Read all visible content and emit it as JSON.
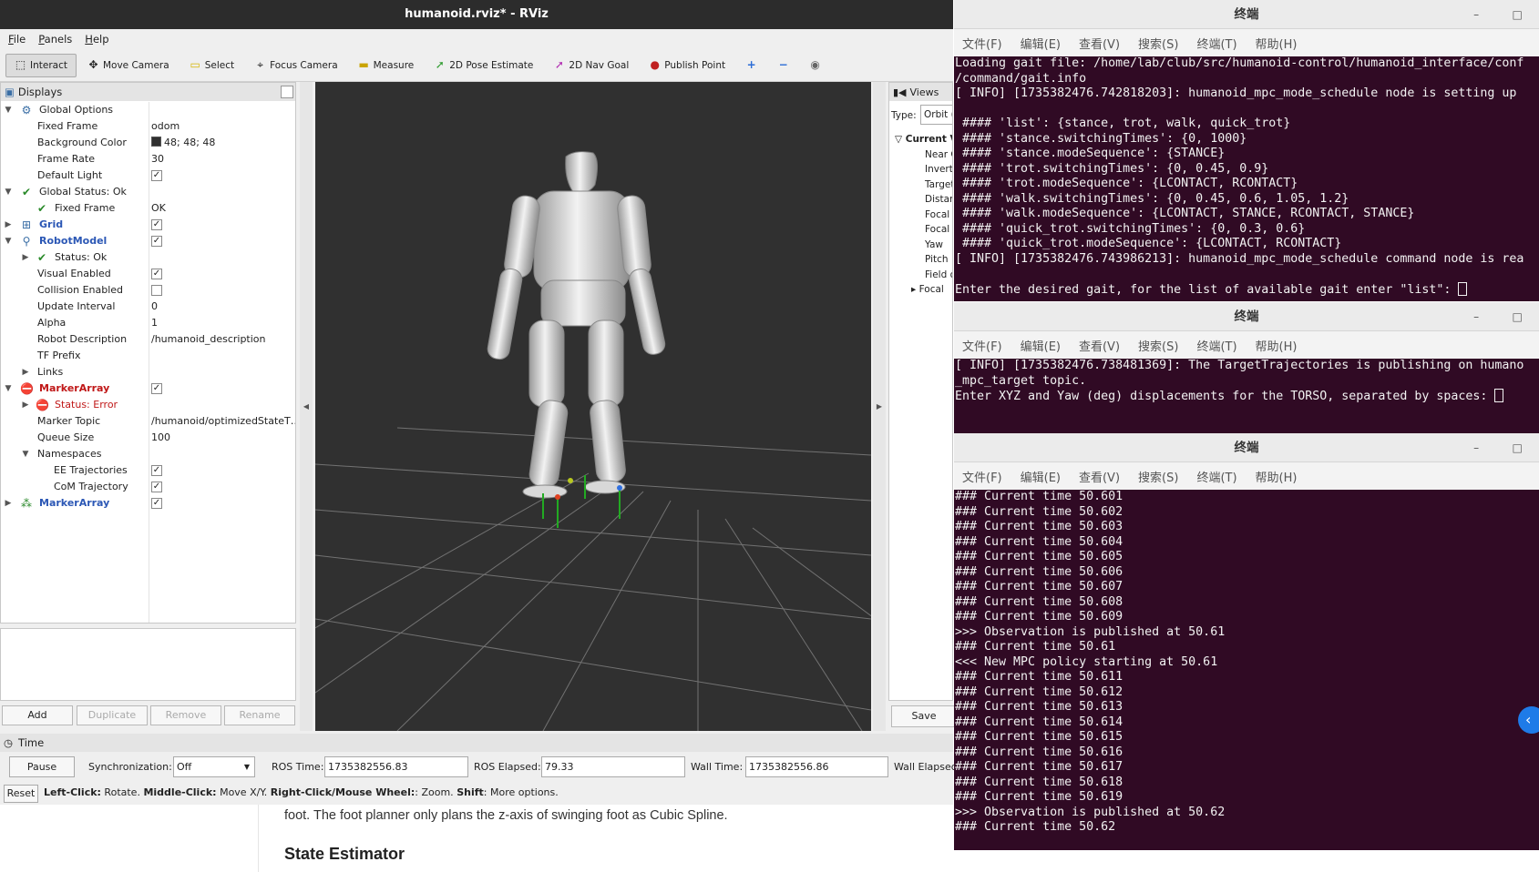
{
  "rviz": {
    "title": "humanoid.rviz* - RViz",
    "menu": [
      "File",
      "Panels",
      "Help"
    ],
    "tools": [
      {
        "label": "Interact",
        "icon": "interact-icon",
        "glyph": "⬚"
      },
      {
        "label": "Move Camera",
        "icon": "move-camera-icon",
        "glyph": "✥"
      },
      {
        "label": "Select",
        "icon": "select-icon",
        "glyph": "▭"
      },
      {
        "label": "Focus Camera",
        "icon": "focus-camera-icon",
        "glyph": "⌖"
      },
      {
        "label": "Measure",
        "icon": "measure-icon",
        "glyph": "▬"
      },
      {
        "label": "2D Pose Estimate",
        "icon": "pose-estimate-icon",
        "glyph": "➚"
      },
      {
        "label": "2D Nav Goal",
        "icon": "nav-goal-icon",
        "glyph": "➚"
      },
      {
        "label": "Publish Point",
        "icon": "publish-point-icon",
        "glyph": "📍"
      }
    ],
    "displays": {
      "title": "Displays",
      "global_options": "Global Options",
      "fixed_frame_label": "Fixed Frame",
      "fixed_frame_value": "odom",
      "bg_color_label": "Background Color",
      "bg_color_value": "48; 48; 48",
      "frame_rate_label": "Frame Rate",
      "frame_rate_value": "30",
      "default_light_label": "Default Light",
      "global_status": "Global Status: Ok",
      "gs_fixed_frame": "Fixed Frame",
      "gs_fixed_frame_value": "OK",
      "grid": "Grid",
      "robot_model": "RobotModel",
      "rm_status": "Status: Ok",
      "visual_enabled": "Visual Enabled",
      "collision_enabled": "Collision Enabled",
      "update_interval": "Update Interval",
      "update_interval_value": "0",
      "alpha": "Alpha",
      "alpha_value": "1",
      "robot_description": "Robot Description",
      "robot_description_value": "/humanoid_description",
      "tf_prefix": "TF Prefix",
      "links": "Links",
      "marker_array": "MarkerArray",
      "ma_status": "Status: Error",
      "marker_topic": "Marker Topic",
      "marker_topic_value": "/humanoid/optimizedStateT…",
      "queue_size": "Queue Size",
      "queue_size_value": "100",
      "namespaces": "Namespaces",
      "ee_traj": "EE Trajectories",
      "com_traj": "CoM Trajectory",
      "marker_array2": "MarkerArray"
    },
    "panel_buttons": {
      "add": "Add",
      "duplicate": "Duplicate",
      "remove": "Remove",
      "rename": "Rename"
    },
    "views": {
      "title": "Views",
      "type_label": "Type:",
      "type_value": "Orbit (",
      "current": "Current V",
      "props": [
        "Near C",
        "Invert",
        "Target",
        "Distan",
        "Focal S",
        "Focal S",
        "Yaw",
        "Pitch",
        "Field o",
        "Focal"
      ],
      "save": "Save"
    },
    "time": {
      "title": "Time",
      "pause": "Pause",
      "sync_label": "Synchronization:",
      "sync_value": "Off",
      "ros_time_label": "ROS Time:",
      "ros_time_value": "1735382556.83",
      "ros_elapsed_label": "ROS Elapsed:",
      "ros_elapsed_value": "79.33",
      "wall_time_label": "Wall Time:",
      "wall_time_value": "1735382556.86",
      "wall_elapsed_label": "Wall Elapsed"
    },
    "status": {
      "reset": "Reset",
      "left_click": "Left-Click:",
      "left_desc": " Rotate. ",
      "middle_click": "Middle-Click:",
      "middle_desc": " Move X/Y. ",
      "right_click": "Right-Click/Mouse Wheel:",
      "right_desc": ": Zoom. ",
      "shift": "Shift",
      "shift_desc": ": More options."
    }
  },
  "browser": {
    "text": "foot. The foot planner only plans the z-axis of swinging foot as Cubic Spline.",
    "heading": "State Estimator"
  },
  "terminal_menu": [
    "文件(F)",
    "编辑(E)",
    "查看(V)",
    "搜索(S)",
    "终端(T)",
    "帮助(H)"
  ],
  "terminals": [
    {
      "title": "终端",
      "lines": [
        "Loading gait file: /home/lab/club/src/humanoid-control/humanoid_interface/conf",
        "/command/gait.info",
        "[ INFO] [1735382476.742818203]: humanoid_mpc_mode_schedule node is setting up",
        "",
        " #### 'list': {stance, trot, walk, quick_trot}",
        " #### 'stance.switchingTimes': {0, 1000}",
        " #### 'stance.modeSequence': {STANCE}",
        " #### 'trot.switchingTimes': {0, 0.45, 0.9}",
        " #### 'trot.modeSequence': {LCONTACT, RCONTACT}",
        " #### 'walk.switchingTimes': {0, 0.45, 0.6, 1.05, 1.2}",
        " #### 'walk.modeSequence': {LCONTACT, STANCE, RCONTACT, STANCE}",
        " #### 'quick_trot.switchingTimes': {0, 0.3, 0.6}",
        " #### 'quick_trot.modeSequence': {LCONTACT, RCONTACT}",
        "[ INFO] [1735382476.743986213]: humanoid_mpc_mode_schedule command node is rea",
        "",
        "Enter the desired gait, for the list of available gait enter \"list\": "
      ]
    },
    {
      "title": "终端",
      "lines": [
        "[ INFO] [1735382476.738481369]: The TargetTrajectories is publishing on humano",
        "_mpc_target topic.",
        "Enter XYZ and Yaw (deg) displacements for the TORSO, separated by spaces: "
      ]
    },
    {
      "title": "终端",
      "lines": [
        "### Current time 50.601",
        "### Current time 50.602",
        "### Current time 50.603",
        "### Current time 50.604",
        "### Current time 50.605",
        "### Current time 50.606",
        "### Current time 50.607",
        "### Current time 50.608",
        "### Current time 50.609",
        ">>> Observation is published at 50.61",
        "### Current time 50.61",
        "<<< New MPC policy starting at 50.61",
        "### Current time 50.611",
        "### Current time 50.612",
        "### Current time 50.613",
        "### Current time 50.614",
        "### Current time 50.615",
        "### Current time 50.616",
        "### Current time 50.617",
        "### Current time 50.618",
        "### Current time 50.619",
        ">>> Observation is published at 50.62",
        "### Current time 50.62"
      ]
    }
  ],
  "colors": {
    "terminal_bg": "#300a24",
    "viewport_bg": "#303030",
    "grid_line": "#8a8a8a"
  }
}
